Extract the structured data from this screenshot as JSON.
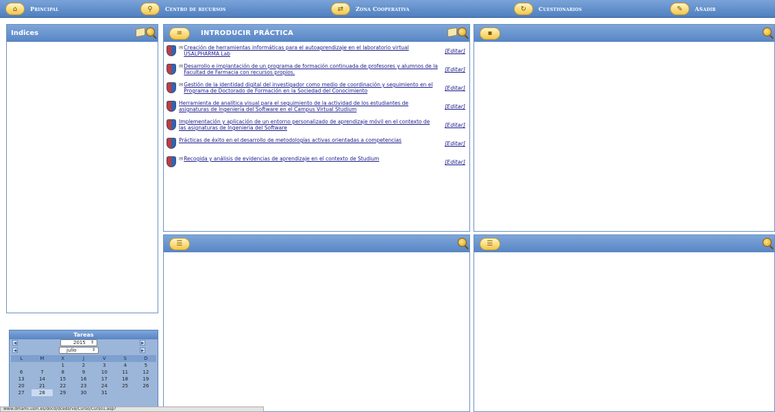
{
  "nav": {
    "items": [
      {
        "label": "Principal",
        "icon": "home-icon"
      },
      {
        "label": "Centro de recursos",
        "icon": "magnifier-icon"
      },
      {
        "label": "Zona Cooperativa",
        "icon": "arrows-icon"
      },
      {
        "label": "Cuestionarios",
        "icon": "refresh-icon"
      },
      {
        "label": "Añadir",
        "icon": "pencil-icon"
      }
    ]
  },
  "indices": {
    "title": "Indices"
  },
  "practica": {
    "title": "INTRODUCIR PRÁCTICA",
    "edit_label": "[Editar]",
    "items": [
      {
        "text": "Creación de herramientas informáticas para el autoaprendizaje en el laboratorio virtual USALPHARMA Lab",
        "checked": true
      },
      {
        "text": "Desarrollo e implantación de un programa de formación continuada de profesores y alumnos de la Facultad de Farmacia con recursos propios.",
        "checked": true
      },
      {
        "text": "Gestión de la identidad digital del investigador como medio de coordinación y seguimiento en el Programa de Doctorado de Formación en la Sociedad del Conocimiento",
        "checked": true
      },
      {
        "text": "Herramienta de analítica visual para el seguimiento de la actividad de los estudiantes de asignaturas de Ingeniería del Software en el Campus Virtual Studium",
        "checked": false
      },
      {
        "text": "Implementación y aplicación de un entorno personalizado de aprendizaje móvil en el contexto de las asignaturas de Ingeniería del Software",
        "checked": false
      },
      {
        "text": "Prácticas de éxito en el desarrollo de metodologías activas orientadas a competencias",
        "checked": false
      },
      {
        "text": "Recogida y análisis de evidencias de aprendizaje en el contexto de Studium",
        "checked": true
      }
    ]
  },
  "calendar": {
    "title": "Tareas",
    "year": "2015",
    "month": "julio",
    "days_header": [
      "L",
      "M",
      "X",
      "J",
      "V",
      "S",
      "D"
    ],
    "weeks": [
      [
        "",
        "",
        "1",
        "2",
        "3",
        "4",
        "5"
      ],
      [
        "6",
        "7",
        "8",
        "9",
        "10",
        "11",
        "12"
      ],
      [
        "13",
        "14",
        "15",
        "16",
        "17",
        "18",
        "19"
      ],
      [
        "20",
        "21",
        "22",
        "23",
        "24",
        "25",
        "26"
      ],
      [
        "27",
        "28",
        "29",
        "30",
        "31",
        "",
        ""
      ]
    ],
    "today": "28"
  },
  "status_url": "www.dmami.usm.es/docd/dcedsrve/Curso/Curso1.asp?"
}
